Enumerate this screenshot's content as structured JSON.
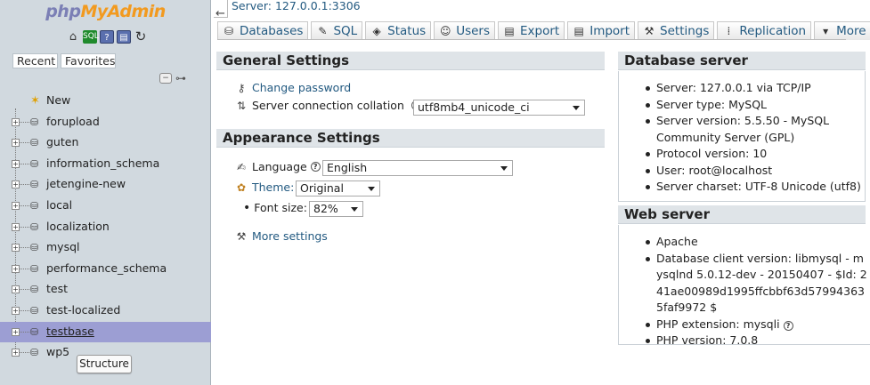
{
  "app": {
    "logo_php": "php",
    "logo_admin": "MyAdmin"
  },
  "nav": {
    "icons": [
      "home-icon",
      "sql-query-icon",
      "docs-icon",
      "console-icon",
      "reload-icon"
    ],
    "tabs": {
      "recent": "Recent",
      "favorites": "Favorites"
    },
    "databases": [
      {
        "name": "New"
      },
      {
        "name": "forupload"
      },
      {
        "name": "guten"
      },
      {
        "name": "information_schema"
      },
      {
        "name": "jetengine-new"
      },
      {
        "name": "local"
      },
      {
        "name": "localization"
      },
      {
        "name": "mysql"
      },
      {
        "name": "performance_schema"
      },
      {
        "name": "test"
      },
      {
        "name": "test-localized"
      },
      {
        "name": "testbase"
      },
      {
        "name": "wp5"
      }
    ],
    "selected": "testbase",
    "structure_label": "Structure"
  },
  "breadcrumb": {
    "server": "Server: 127.0.0.1:3306"
  },
  "menu": {
    "databases": "Databases",
    "sql": "SQL",
    "status": "Status",
    "users": "Users",
    "export": "Export",
    "import": "Import",
    "settings": "Settings",
    "replication": "Replication",
    "more": "More"
  },
  "general": {
    "title": "General Settings",
    "change_password": "Change password",
    "collation_label": "Server connection collation",
    "collation_value": "utf8mb4_unicode_ci"
  },
  "appearance": {
    "title": "Appearance Settings",
    "language_label": "Language",
    "language_value": "English",
    "theme_label": "Theme:",
    "theme_value": "Original",
    "font_label": "Font size:",
    "font_value": "82%",
    "more_settings": "More settings"
  },
  "db_server": {
    "title": "Database server",
    "items": [
      "Server: 127.0.0.1 via TCP/IP",
      "Server type: MySQL",
      "Server version: 5.5.50 - MySQL Community Server (GPL)",
      "Protocol version: 10",
      "User: root@localhost",
      "Server charset: UTF-8 Unicode (utf8)"
    ]
  },
  "web_server": {
    "title": "Web server",
    "items": [
      "Apache",
      "Database client version: libmysql - mysqlnd 5.0.12-dev - 20150407 - $Id: 241ae00989d1995ffcbbf63d579943635faf9972 $",
      "PHP extension: mysqli",
      "PHP version: 7.0.8"
    ]
  }
}
